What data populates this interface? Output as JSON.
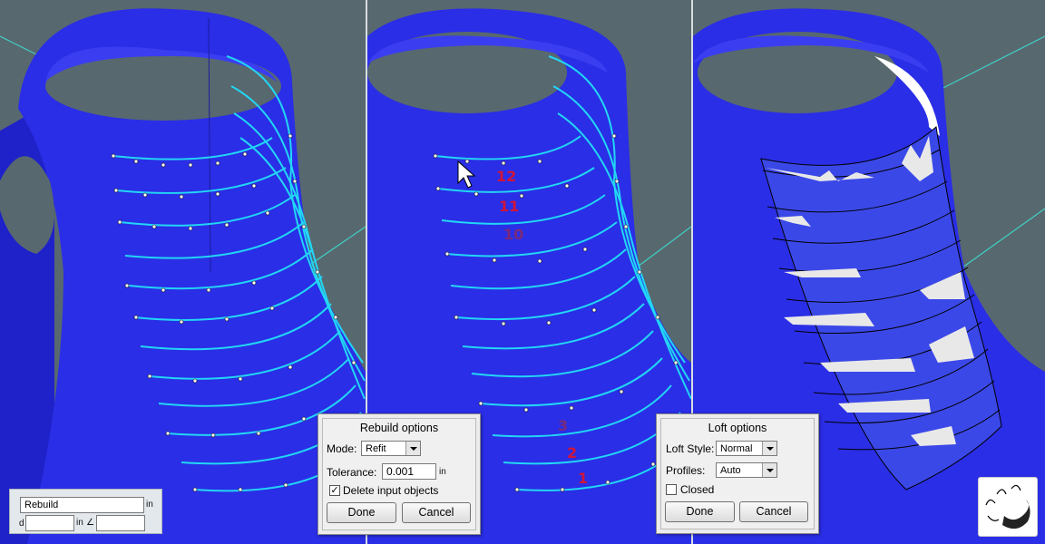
{
  "colors": {
    "background": "#58686f",
    "surface": "#2a2ee6",
    "curve": "#22d6f5",
    "point": "#ffffff",
    "number_label": "#d0153a",
    "grid_line": "#3fd1c6"
  },
  "command_line": {
    "command": "Rebuild",
    "unit_top": "in",
    "prefix_label": "d",
    "distance_value": "",
    "unit_mid": "in",
    "angle_symbol": "∠",
    "angle_value": ""
  },
  "curve_numbers": [
    "12",
    "11",
    "10",
    "3",
    "2",
    "1"
  ],
  "rebuild_dialog": {
    "title": "Rebuild options",
    "mode_label": "Mode:",
    "mode_value": "Refit",
    "tolerance_label": "Tolerance:",
    "tolerance_value": "0.001",
    "tolerance_unit": "in",
    "delete_label": "Delete input objects",
    "delete_checked": true,
    "done_label": "Done",
    "cancel_label": "Cancel"
  },
  "loft_dialog": {
    "title": "Loft options",
    "style_label": "Loft Style:",
    "style_value": "Normal",
    "profiles_label": "Profiles:",
    "profiles_value": "Auto",
    "closed_label": "Closed",
    "closed_checked": false,
    "done_label": "Done",
    "cancel_label": "Cancel"
  },
  "logo": {
    "icon": "app-logo-icon"
  }
}
